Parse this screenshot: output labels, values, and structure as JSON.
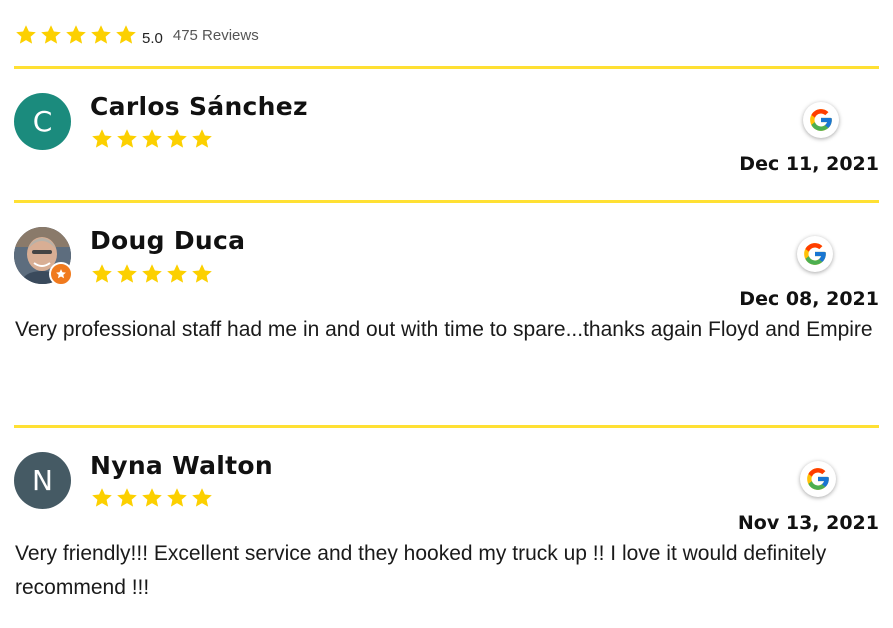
{
  "summary": {
    "rating": "5.0",
    "count_label": "475 Reviews",
    "stars": 5
  },
  "colors": {
    "star": "#fcd000",
    "divider": "#ffe033",
    "avatar_c": "#1b8b7d",
    "avatar_n": "#455a64",
    "badge": "#f07a1e"
  },
  "reviews": [
    {
      "initial": "C",
      "name": "Carlos Sánchez",
      "date": "Dec 11, 2021",
      "text": "",
      "stars": 5,
      "source_icon": "google-icon"
    },
    {
      "initial": "",
      "name": "Doug Duca",
      "date": "Dec 08, 2021",
      "text": "Very professional staff had me in and out with time to spare...thanks again Floyd and Empire",
      "stars": 5,
      "source_icon": "google-icon",
      "badge_icon": "star-badge-icon"
    },
    {
      "initial": "N",
      "name": "Nyna Walton",
      "date": "Nov 13, 2021",
      "text": "Very friendly!!! Excellent service and they hooked my truck up !! I love it would definitely recommend !!!",
      "stars": 5,
      "source_icon": "google-icon"
    }
  ]
}
